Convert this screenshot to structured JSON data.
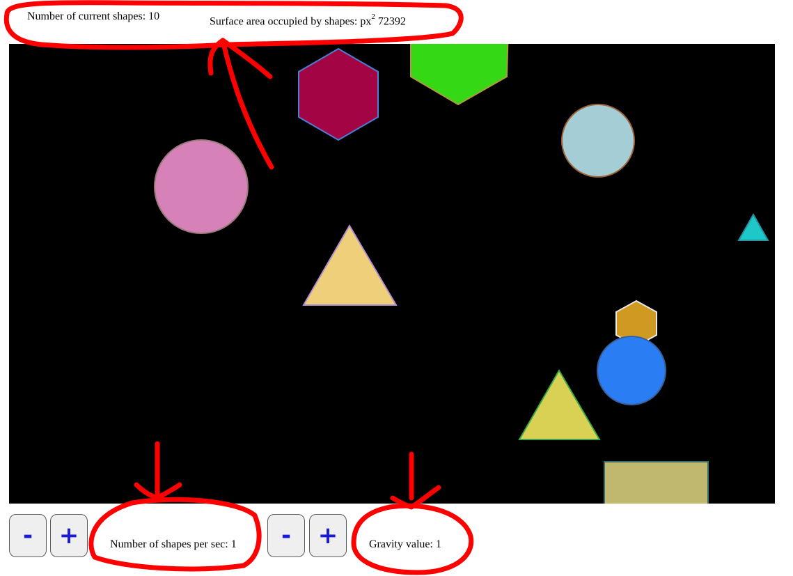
{
  "stats": {
    "shape_count_label": "Number of current shapes:",
    "shape_count_value": "10",
    "area_label": "Surface area occupied by shapes: px",
    "area_unit_exp": "2",
    "area_value": "72392"
  },
  "controls": {
    "rate_minus_label": "-",
    "rate_plus_label": "+",
    "rate_label": "Number of shapes per sec:",
    "rate_value": "1",
    "gravity_minus_label": "-",
    "gravity_plus_label": "+",
    "gravity_label": "Gravity value:",
    "gravity_value": "1"
  },
  "canvas": {
    "background": "#000000",
    "shapes": [
      {
        "kind": "hexagon",
        "fill": "#a30544",
        "stroke": "#4a7fd6"
      },
      {
        "kind": "pentagon",
        "fill": "#34d814",
        "stroke": "#b09a3e"
      },
      {
        "kind": "circle",
        "fill": "#a5cdd6",
        "stroke": "#a0643a"
      },
      {
        "kind": "circle",
        "fill": "#d681b8",
        "stroke": "#9a7a7a"
      },
      {
        "kind": "triangle",
        "fill": "#1ec8c8",
        "stroke": "#2a8fa0"
      },
      {
        "kind": "triangle",
        "fill": "#efd07a",
        "stroke": "#b48fcf"
      },
      {
        "kind": "hexagon",
        "fill": "#d09a22",
        "stroke": "#e8e8e8"
      },
      {
        "kind": "circle",
        "fill": "#2a7df2",
        "stroke": "#3a5f9a"
      },
      {
        "kind": "triangle",
        "fill": "#d8d154",
        "stroke": "#3aa84a"
      },
      {
        "kind": "rectangle",
        "fill": "#c0b86e",
        "stroke": "#3a6f6a"
      }
    ]
  },
  "annotation_color": "#ff0000"
}
